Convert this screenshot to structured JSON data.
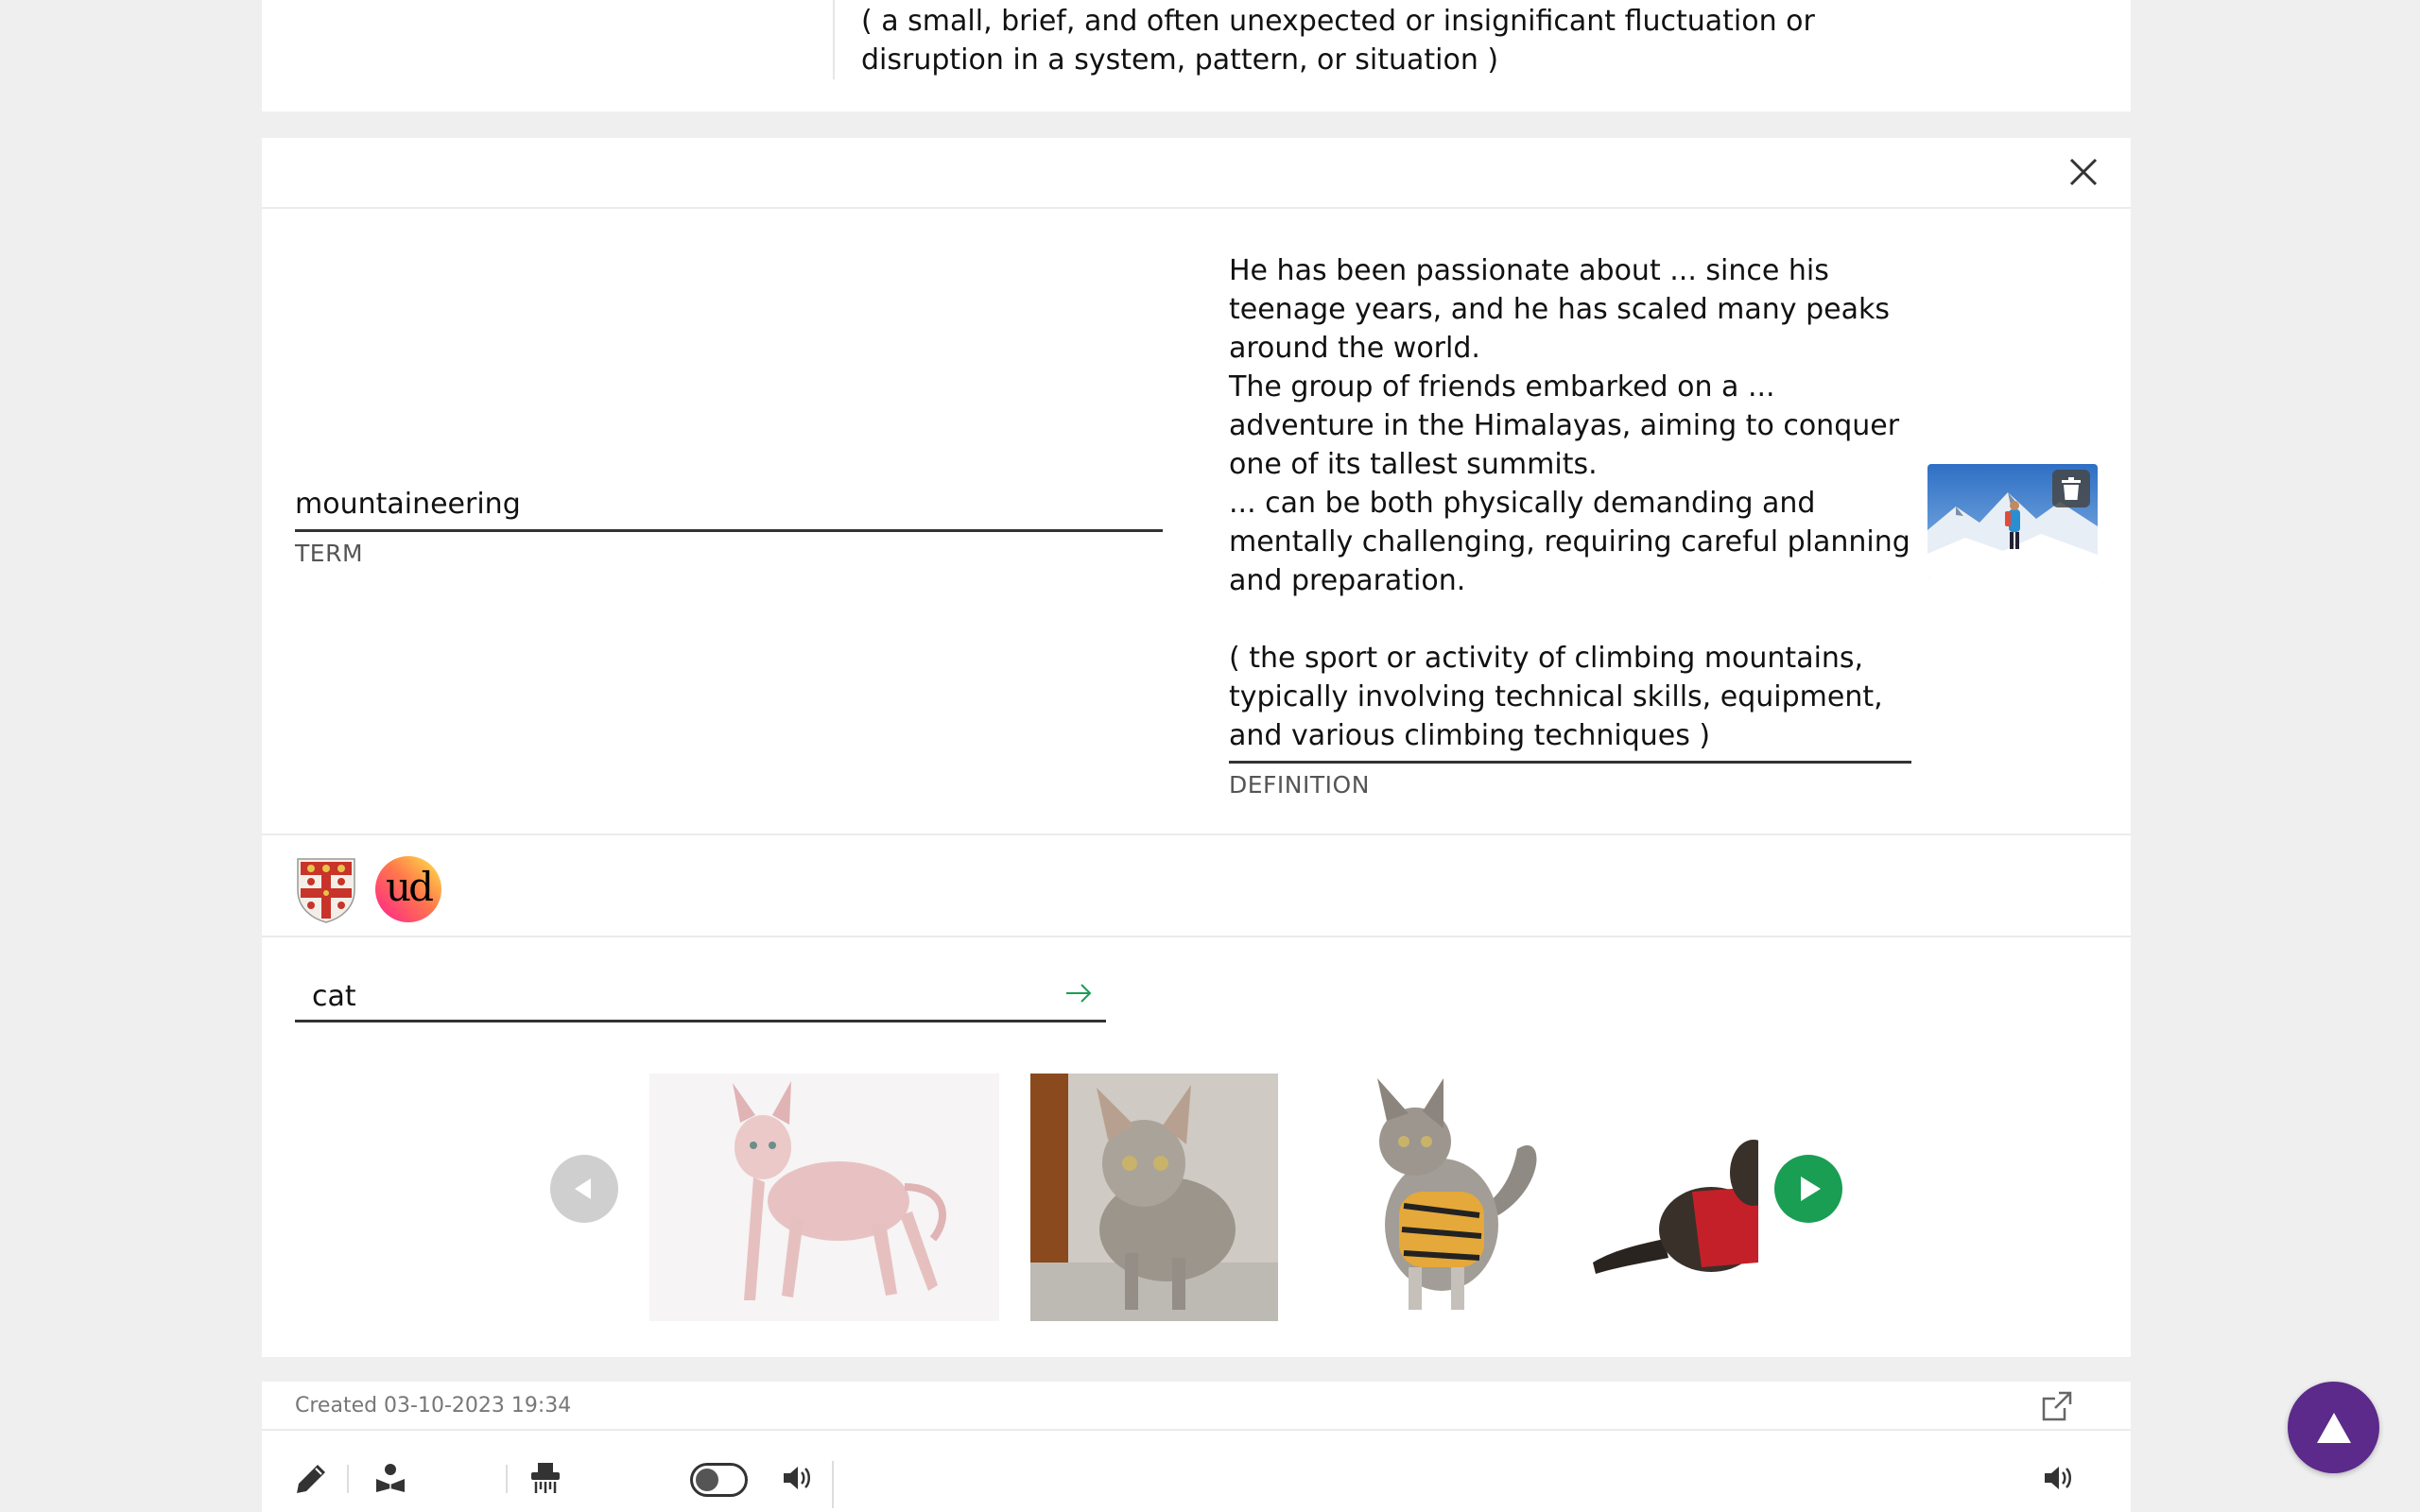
{
  "previous_card": {
    "definition": "( a small, brief, and often unexpected or insignificant fluctuation or disruption in a system, pattern, or situation )"
  },
  "card": {
    "term": "mountaineering",
    "term_label": "TERM",
    "definition": "He has been passionate about ... since his teenage years, and he has scaled many peaks around the world.\nThe group of friends embarked on a ... adventure in the Himalayas, aiming to conquer one of its tallest summits.\n... can be both physically demanding and mentally challenging, requiring careful planning and preparation.\n\n( the sport or activity of climbing mountains, typically involving technical skills, equipment, and various climbing techniques )",
    "definition_label": "DEFINITION"
  },
  "dictionaries": {
    "urban_dictionary_text": "ud"
  },
  "image_search": {
    "query": "cat"
  },
  "footer": {
    "created": "Created 03-10-2023 19:34"
  },
  "colors": {
    "accent_green": "#1a9e53",
    "fab_purple": "#5b2a8a"
  }
}
